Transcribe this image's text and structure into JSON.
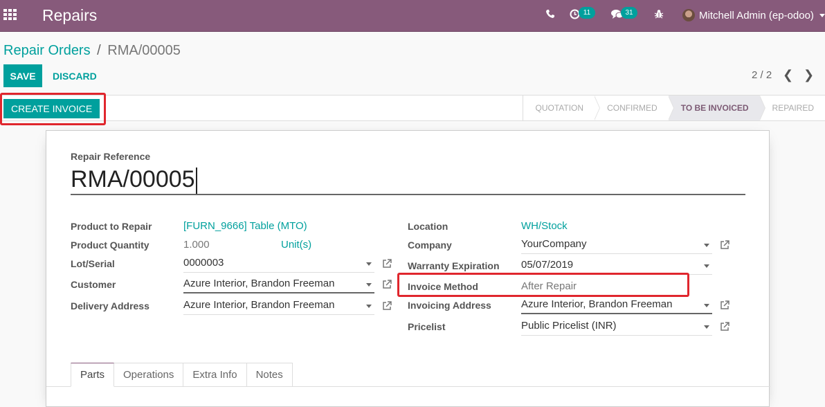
{
  "navbar": {
    "app_title": "Repairs",
    "activity_count": "11",
    "messages_count": "31",
    "user_name": "Mitchell Admin (ep-odoo)",
    "icons": [
      "apps-icon",
      "phone-icon",
      "clock-icon",
      "chat-icon",
      "bug-icon"
    ]
  },
  "breadcrumb": {
    "parent": "Repair Orders",
    "separator": "/",
    "current": "RMA/00005"
  },
  "toolbar": {
    "save_label": "SAVE",
    "discard_label": "DISCARD",
    "pager": "2 / 2",
    "prev": "❮",
    "next": "❯"
  },
  "statusbar": {
    "create_invoice_label": "CREATE INVOICE",
    "stages": [
      {
        "label": "QUOTATION",
        "active": false
      },
      {
        "label": "CONFIRMED",
        "active": false
      },
      {
        "label": "TO BE INVOICED",
        "active": true
      },
      {
        "label": "REPAIRED",
        "active": false
      }
    ]
  },
  "form": {
    "reference_label": "Repair Reference",
    "reference_value": "RMA/00005",
    "left": {
      "product_label": "Product to Repair",
      "product_value": "[FURN_9666] Table (MTO)",
      "quantity_label": "Product Quantity",
      "quantity_value": "1.000",
      "uom_value": "Unit(s)",
      "lot_label": "Lot/Serial",
      "lot_value": "0000003",
      "customer_label": "Customer",
      "customer_value": "Azure Interior, Brandon Freeman",
      "delivery_label": "Delivery Address",
      "delivery_value": "Azure Interior, Brandon Freeman"
    },
    "right": {
      "location_label": "Location",
      "location_value": "WH/Stock",
      "company_label": "Company",
      "company_value": "YourCompany",
      "warranty_label": "Warranty Expiration",
      "warranty_value": "05/07/2019",
      "invoice_method_label": "Invoice Method",
      "invoice_method_value": "After Repair",
      "invoicing_address_label": "Invoicing Address",
      "invoicing_address_value": "Azure Interior, Brandon Freeman",
      "pricelist_label": "Pricelist",
      "pricelist_value": "Public Pricelist (INR)"
    },
    "tabs": [
      "Parts",
      "Operations",
      "Extra Info",
      "Notes"
    ],
    "active_tab": "Parts"
  },
  "colors": {
    "brand": "#875a7b",
    "accent": "#00a09d",
    "highlight": "#e0262d"
  }
}
